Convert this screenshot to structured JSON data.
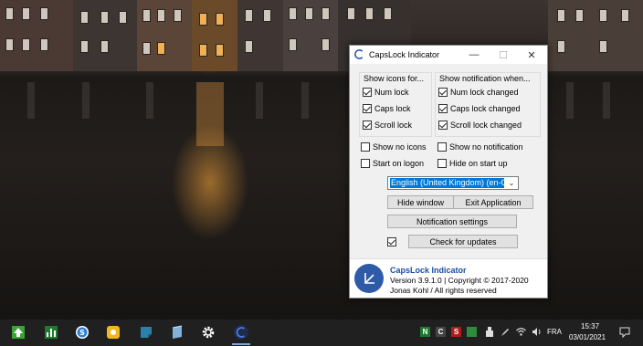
{
  "window": {
    "title": "CapsLock Indicator",
    "minimize_glyph": "—",
    "maximize_glyph": "☐",
    "close_glyph": "✕"
  },
  "show_icons_group": {
    "title": "Show icons for...",
    "items": [
      {
        "label": "Num lock",
        "checked": true
      },
      {
        "label": "Caps lock",
        "checked": true
      },
      {
        "label": "Scroll lock",
        "checked": true
      }
    ]
  },
  "show_notification_group": {
    "title": "Show notification when...",
    "items": [
      {
        "label": "Num lock changed",
        "checked": true
      },
      {
        "label": "Caps lock changed",
        "checked": true
      },
      {
        "label": "Scroll lock changed",
        "checked": true
      }
    ]
  },
  "options": [
    {
      "label": "Show no icons",
      "checked": false
    },
    {
      "label": "Show no notification",
      "checked": false
    },
    {
      "label": "Start on logon",
      "checked": false
    },
    {
      "label": "Hide on start up",
      "checked": false
    }
  ],
  "language_select": {
    "value": "English (United Kingdom) (en-G",
    "arrow": "⌄"
  },
  "buttons": {
    "hide_window": "Hide window",
    "exit_application": "Exit Application",
    "notification_settings": "Notification settings",
    "check_for_updates": "Check for updates"
  },
  "check_updates_checkbox": {
    "checked": true
  },
  "footer": {
    "app_name": "CapsLock Indicator",
    "version": "Version 3.9.1.0 | Copyright © 2017-2020",
    "author": "Jonas Kohl / All rights reserved"
  },
  "taskbar": {
    "apps": [
      "uparrow-app-icon",
      "chart-app-icon",
      "s-circle-app-icon",
      "yellow-app-icon",
      "note-app-icon",
      "notebook-app-icon",
      "settings-gear-icon",
      "capslock-indicator-app-icon"
    ],
    "tray": {
      "n_label": "N",
      "c_label": "C",
      "s_label": "S",
      "language": "FRA",
      "time": "15:37",
      "date": "03/01/2021"
    }
  },
  "colors": {
    "accent": "#0078d7",
    "brand_blue": "#1c4fa0",
    "taskbar": "#202020"
  }
}
